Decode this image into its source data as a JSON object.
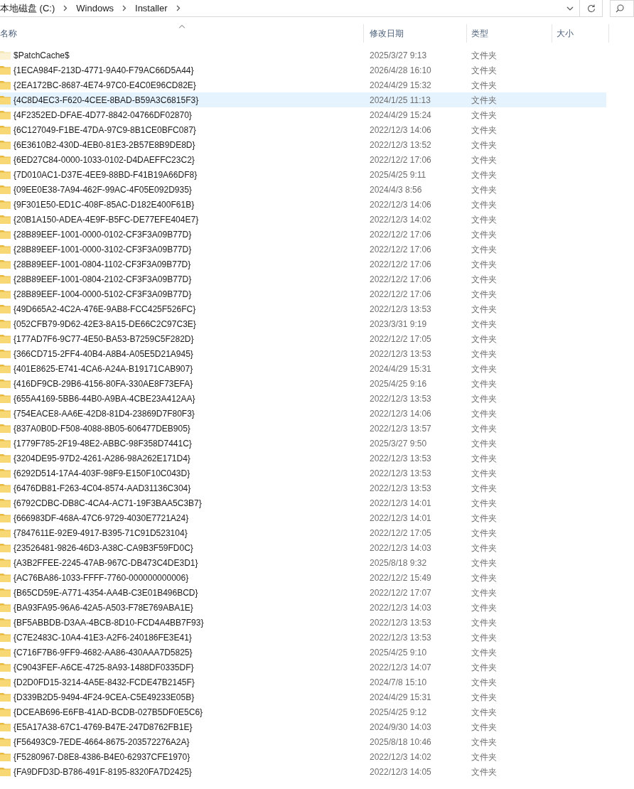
{
  "address_bar": {
    "breadcrumbs": [
      "本地磁盘 (C:)",
      "Windows",
      "Installer"
    ]
  },
  "table": {
    "columns": [
      {
        "label": "名称",
        "sorted": true
      },
      {
        "label": "修改日期",
        "sorted": false
      },
      {
        "label": "类型",
        "sorted": false
      },
      {
        "label": "大小",
        "sorted": false
      }
    ],
    "rows": [
      {
        "name": "$PatchCache$",
        "modified": "2025/3/27 9:13",
        "type": "文件夹",
        "hidden": true,
        "selected": false
      },
      {
        "name": "{1ECA984F-213D-4771-9A40-F79AC66D5A44}",
        "modified": "2026/4/28 16:10",
        "type": "文件夹",
        "hidden": false,
        "selected": false
      },
      {
        "name": "{2EA172BC-8687-4E74-97C0-E4C0E96CD82E}",
        "modified": "2024/4/29 15:32",
        "type": "文件夹",
        "hidden": false,
        "selected": false
      },
      {
        "name": "{4C8D4EC3-F620-4CEE-8BAD-B59A3C6815F3}",
        "modified": "2024/1/25 11:13",
        "type": "文件夹",
        "hidden": false,
        "selected": true
      },
      {
        "name": "{4F2352ED-DFAE-4D77-8842-04766DF02870}",
        "modified": "2024/4/29 15:24",
        "type": "文件夹",
        "hidden": false,
        "selected": false
      },
      {
        "name": "{6C127049-F1BE-47DA-97C9-8B1CE0BFC087}",
        "modified": "2022/12/3 14:06",
        "type": "文件夹",
        "hidden": false,
        "selected": false
      },
      {
        "name": "{6E3610B2-430D-4EB0-81E3-2B57E8B9DE8D}",
        "modified": "2022/12/3 13:52",
        "type": "文件夹",
        "hidden": false,
        "selected": false
      },
      {
        "name": "{6ED27C84-0000-1033-0102-D4DAEFFC23C2}",
        "modified": "2022/12/2 17:06",
        "type": "文件夹",
        "hidden": false,
        "selected": false
      },
      {
        "name": "{7D010AC1-D37E-4EE9-88BD-F41B19A66DF8}",
        "modified": "2025/4/25 9:11",
        "type": "文件夹",
        "hidden": false,
        "selected": false
      },
      {
        "name": "{09EE0E38-7A94-462F-99AC-4F05E092D935}",
        "modified": "2024/4/3 8:56",
        "type": "文件夹",
        "hidden": false,
        "selected": false
      },
      {
        "name": "{9F301E50-ED1C-408F-85AC-D182E400F61B}",
        "modified": "2022/12/3 14:06",
        "type": "文件夹",
        "hidden": false,
        "selected": false
      },
      {
        "name": "{20B1A150-ADEA-4E9F-B5FC-DE77EFE404E7}",
        "modified": "2022/12/3 14:02",
        "type": "文件夹",
        "hidden": false,
        "selected": false
      },
      {
        "name": "{28B89EEF-1001-0000-0102-CF3F3A09B77D}",
        "modified": "2022/12/2 17:06",
        "type": "文件夹",
        "hidden": false,
        "selected": false
      },
      {
        "name": "{28B89EEF-1001-0000-3102-CF3F3A09B77D}",
        "modified": "2022/12/2 17:06",
        "type": "文件夹",
        "hidden": false,
        "selected": false
      },
      {
        "name": "{28B89EEF-1001-0804-1102-CF3F3A09B77D}",
        "modified": "2022/12/2 17:06",
        "type": "文件夹",
        "hidden": false,
        "selected": false
      },
      {
        "name": "{28B89EEF-1001-0804-2102-CF3F3A09B77D}",
        "modified": "2022/12/2 17:06",
        "type": "文件夹",
        "hidden": false,
        "selected": false
      },
      {
        "name": "{28B89EEF-1004-0000-5102-CF3F3A09B77D}",
        "modified": "2022/12/2 17:06",
        "type": "文件夹",
        "hidden": false,
        "selected": false
      },
      {
        "name": "{49D665A2-4C2A-476E-9AB8-FCC425F526FC}",
        "modified": "2022/12/3 13:53",
        "type": "文件夹",
        "hidden": false,
        "selected": false
      },
      {
        "name": "{052CFB79-9D62-42E3-8A15-DE66C2C97C3E}",
        "modified": "2023/3/31 9:19",
        "type": "文件夹",
        "hidden": false,
        "selected": false
      },
      {
        "name": "{177AD7F6-9C77-4E50-BA53-B7259C5F282D}",
        "modified": "2022/12/2 17:05",
        "type": "文件夹",
        "hidden": false,
        "selected": false
      },
      {
        "name": "{366CD715-2FF4-40B4-A8B4-A05E5D21A945}",
        "modified": "2022/12/3 13:53",
        "type": "文件夹",
        "hidden": false,
        "selected": false
      },
      {
        "name": "{401E8625-E741-4CA6-A24A-B19171CAB907}",
        "modified": "2024/4/29 15:31",
        "type": "文件夹",
        "hidden": false,
        "selected": false
      },
      {
        "name": "{416DF9CB-29B6-4156-80FA-330AE8F73EFA}",
        "modified": "2025/4/25 9:16",
        "type": "文件夹",
        "hidden": false,
        "selected": false
      },
      {
        "name": "{655A4169-5BB6-44B0-A9BA-4CBE23A412AA}",
        "modified": "2022/12/3 13:53",
        "type": "文件夹",
        "hidden": false,
        "selected": false
      },
      {
        "name": "{754EACE8-AA6E-42D8-81D4-23869D7F80F3}",
        "modified": "2022/12/3 14:06",
        "type": "文件夹",
        "hidden": false,
        "selected": false
      },
      {
        "name": "{837A0B0D-F508-4088-8B05-606477DEB905}",
        "modified": "2022/12/3 13:57",
        "type": "文件夹",
        "hidden": false,
        "selected": false
      },
      {
        "name": "{1779F785-2F19-48E2-ABBC-98F358D7441C}",
        "modified": "2025/3/27 9:50",
        "type": "文件夹",
        "hidden": false,
        "selected": false
      },
      {
        "name": "{3204DE95-97D2-4261-A286-98A262E171D4}",
        "modified": "2022/12/3 13:53",
        "type": "文件夹",
        "hidden": false,
        "selected": false
      },
      {
        "name": "{6292D514-17A4-403F-98F9-E150F10C043D}",
        "modified": "2022/12/3 13:53",
        "type": "文件夹",
        "hidden": false,
        "selected": false
      },
      {
        "name": "{6476DB81-F263-4C04-8574-AAD31136C304}",
        "modified": "2022/12/3 13:53",
        "type": "文件夹",
        "hidden": false,
        "selected": false
      },
      {
        "name": "{6792CDBC-DB8C-4CA4-AC71-19F3BAA5C3B7}",
        "modified": "2022/12/3 14:01",
        "type": "文件夹",
        "hidden": false,
        "selected": false
      },
      {
        "name": "{666983DF-468A-47C6-9729-4030E7721A24}",
        "modified": "2022/12/3 14:01",
        "type": "文件夹",
        "hidden": false,
        "selected": false
      },
      {
        "name": "{7847611E-92E9-4917-B395-71C91D523104}",
        "modified": "2022/12/2 17:05",
        "type": "文件夹",
        "hidden": false,
        "selected": false
      },
      {
        "name": "{23526481-9826-46D3-A38C-CA9B3F59FD0C}",
        "modified": "2022/12/3 14:03",
        "type": "文件夹",
        "hidden": false,
        "selected": false
      },
      {
        "name": "{A3B2FFEE-2245-47AB-967C-DB473C4DE3D1}",
        "modified": "2025/8/18 9:32",
        "type": "文件夹",
        "hidden": false,
        "selected": false
      },
      {
        "name": "{AC76BA86-1033-FFFF-7760-000000000006}",
        "modified": "2022/12/2 15:49",
        "type": "文件夹",
        "hidden": false,
        "selected": false
      },
      {
        "name": "{B65CD59E-A771-4354-AA4B-C3E01B496BCD}",
        "modified": "2022/12/2 17:07",
        "type": "文件夹",
        "hidden": false,
        "selected": false
      },
      {
        "name": "{BA93FA95-96A6-42A5-A503-F78E769ABA1E}",
        "modified": "2022/12/3 14:03",
        "type": "文件夹",
        "hidden": false,
        "selected": false
      },
      {
        "name": "{BF5ABBDB-D3AA-4BCB-8D10-FCD4A4BB7F93}",
        "modified": "2022/12/3 13:53",
        "type": "文件夹",
        "hidden": false,
        "selected": false
      },
      {
        "name": "{C7E2483C-10A4-41E3-A2F6-240186FE3E41}",
        "modified": "2022/12/3 13:53",
        "type": "文件夹",
        "hidden": false,
        "selected": false
      },
      {
        "name": "{C716F7B6-9FF9-4682-AA86-430AAA7D5825}",
        "modified": "2025/4/25 9:10",
        "type": "文件夹",
        "hidden": false,
        "selected": false
      },
      {
        "name": "{C9043FEF-A6CE-4725-8A93-1488DF0335DF}",
        "modified": "2022/12/3 14:07",
        "type": "文件夹",
        "hidden": false,
        "selected": false
      },
      {
        "name": "{D2D0FD15-3214-4A5E-8432-FCDE47B2145F}",
        "modified": "2024/7/8 15:10",
        "type": "文件夹",
        "hidden": false,
        "selected": false
      },
      {
        "name": "{D339B2D5-9494-4F24-9CEA-C5E49233E05B}",
        "modified": "2024/4/29 15:31",
        "type": "文件夹",
        "hidden": false,
        "selected": false
      },
      {
        "name": "{DCEAB696-E6FB-41AD-BCDB-027B5DF0E5C6}",
        "modified": "2025/4/25 9:12",
        "type": "文件夹",
        "hidden": false,
        "selected": false
      },
      {
        "name": "{E5A17A38-67C1-4769-B47E-247D8762FB1E}",
        "modified": "2024/9/30 14:03",
        "type": "文件夹",
        "hidden": false,
        "selected": false
      },
      {
        "name": "{F56493C9-7EDE-4664-8675-203572276A2A}",
        "modified": "2025/8/18 10:46",
        "type": "文件夹",
        "hidden": false,
        "selected": false
      },
      {
        "name": "{F5280967-D8E8-4386-B4E0-62937CFE1970}",
        "modified": "2022/12/3 14:02",
        "type": "文件夹",
        "hidden": false,
        "selected": false
      },
      {
        "name": "{FA9DFD3D-B786-491F-8195-8320FA7D2425}",
        "modified": "2022/12/3 14:05",
        "type": "文件夹",
        "hidden": false,
        "selected": false
      }
    ]
  }
}
